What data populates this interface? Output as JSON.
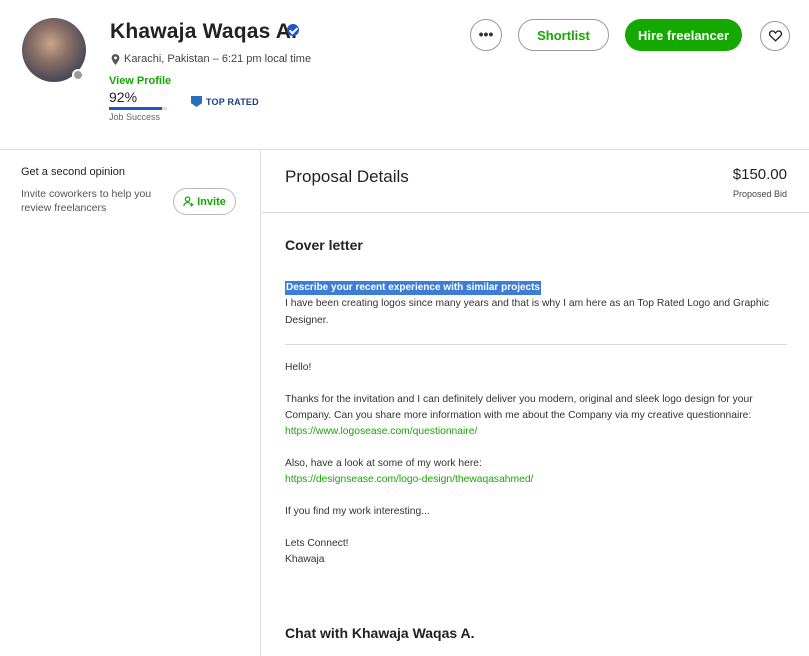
{
  "freelancer": {
    "name": "Khawaja Waqas A.",
    "location": "Karachi, Pakistan – 6:21 pm local time",
    "view_profile": "View Profile",
    "job_success_percent": "92%",
    "job_success_value": 0.92,
    "job_success_label": "Job Success",
    "badge": "TOP RATED"
  },
  "actions": {
    "more": "•••",
    "shortlist": "Shortlist",
    "hire": "Hire freelancer"
  },
  "sidebar": {
    "title": "Get a second opinion",
    "description": "Invite coworkers to help you review freelancers",
    "invite": "Invite"
  },
  "proposal": {
    "title": "Proposal Details",
    "bid_amount": "$150.00",
    "bid_label": "Proposed Bid",
    "cover_title": "Cover letter",
    "question": "Describe your recent experience with similar projects",
    "answer": "I have been creating logos since many years and that is why I am here as an Top Rated Logo and Graphic Designer.",
    "letter": {
      "hello": "Hello!",
      "para1": "Thanks for the invitation and I can definitely deliver you modern, original and sleek logo design for your Company. Can you share more information with me about the Company via my creative questionnaire:",
      "link1": "https://www.logosease.com/questionnaire/",
      "para2": "Also, have a look at some of my work here:",
      "link2": "https://designsease.com/logo-design/thewaqasahmed/",
      "para3": "If you find my work interesting...",
      "closing": "Lets Connect!",
      "signature": "Khawaja"
    },
    "chat_title": "Chat with Khawaja Waqas A."
  },
  "colors": {
    "brand_green": "#14a800",
    "top_rated_blue": "#2b6fb8",
    "highlight": "#3d7dd8"
  }
}
